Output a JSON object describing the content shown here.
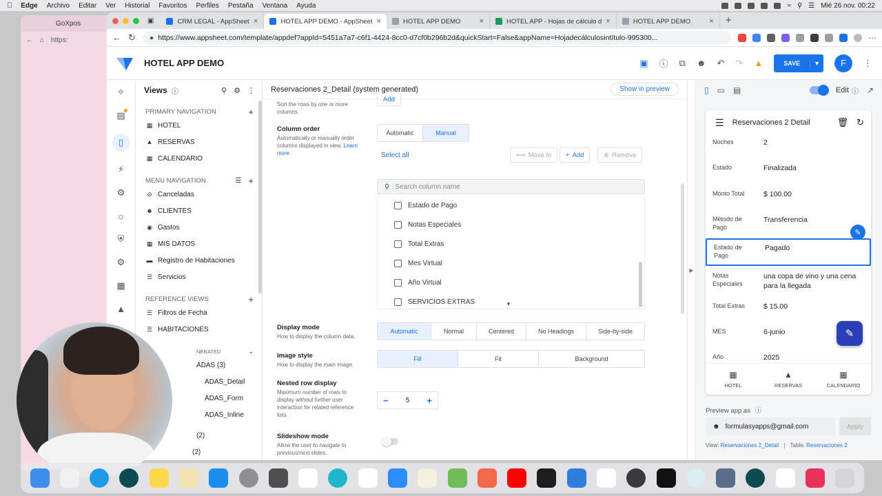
{
  "menubar": {
    "items": [
      "Edge",
      "Archivo",
      "Editar",
      "Ver",
      "Historial",
      "Favoritos",
      "Perfiles",
      "Pestaña",
      "Ventana",
      "Ayuda"
    ],
    "datetime": "Mié 26 nov. 00:22"
  },
  "back_window": {
    "tab": "GoXpos",
    "url": "https:"
  },
  "browser": {
    "tabs": [
      {
        "label": "CRM LEGAL - AppSheet",
        "color": "#1a73e8"
      },
      {
        "label": "HOTEL APP DEMO - AppSheet",
        "color": "#1a73e8"
      },
      {
        "label": "HOTEL APP DEMO",
        "color": "#9aa0a6"
      },
      {
        "label": "HOTEL APP - Hojas de cálculo d",
        "color": "#0f9d58"
      },
      {
        "label": "HOTEL APP DEMO",
        "color": "#9aa0a6"
      }
    ],
    "url": "https://www.appsheet.com/template/appdef?appId=5451a7a7-c6f1-4424-8cc0-d7cf0b296b2d&quickStart=False&appName=Hojadecálculosintítulo-995300..."
  },
  "app": {
    "title": "HOTEL APP DEMO",
    "save_label": "SAVE",
    "avatar_letter": "F"
  },
  "views_panel": {
    "title": "Views",
    "primary_label": "PRIMARY NAVIGATION",
    "primary_items": [
      "HOTEL",
      "RESERVAS",
      "CALENDARIO"
    ],
    "menu_label": "MENU NAVIGATION",
    "menu_items": [
      "Canceladas",
      "CLIENTES",
      "Gastos",
      "MIS DATOS",
      "Registro de Habitaciones",
      "Servicios"
    ],
    "reference_label": "REFERENCE VIEWS",
    "reference_items": [
      "Filtros de Fecha",
      "HABITACIONES"
    ],
    "generated_label": "NERATED",
    "generated_items": [
      "ADAS (3)",
      "ADAS_Detail",
      "ADAS_Form",
      "ADAS_Inline",
      "(2)",
      "(2)"
    ]
  },
  "editor": {
    "title": "Reservaciones 2_Detail (system generated)",
    "show_in_preview": "Show in preview",
    "sort_desc": "Sort the rows by one or more columns.",
    "add_top": "Add",
    "column_order": {
      "label": "Column order",
      "desc": "Automatically or manually order columns displayed in view.",
      "link": "Learn more",
      "options": [
        "Automatic",
        "Manual"
      ],
      "selected": "Manual",
      "select_all": "Select all",
      "move_to": "Move to",
      "add": "Add",
      "remove": "Remove",
      "search_placeholder": "Search column name",
      "columns": [
        "Estado de Pago",
        "Notas Especiales",
        "Total Extras",
        "Mes Virtual",
        "Año Virtual",
        "SERVICIOS EXTRAS"
      ]
    },
    "display_mode": {
      "label": "Display mode",
      "desc": "How to display the column data.",
      "options": [
        "Automatic",
        "Normal",
        "Centered",
        "No Headings",
        "Side-by-side"
      ],
      "selected": "Automatic"
    },
    "image_style": {
      "label": "Image style",
      "desc": "How to display the main image.",
      "options": [
        "Fill",
        "Fit",
        "Background"
      ],
      "selected": "Fill"
    },
    "nested": {
      "label": "Nested row display",
      "desc": "Maximum number of rows to display without further user interaction for related reference lists.",
      "value": "5"
    },
    "slideshow": {
      "label": "Slideshow mode",
      "desc": "Allow the user to navigate to previous/next slides."
    }
  },
  "preview": {
    "edit_label": "Edit",
    "screen_title": "Reservaciones 2 Detail",
    "fields": [
      {
        "label": "Noches",
        "value": "2"
      },
      {
        "label": "Estado",
        "value": "Finalizada"
      },
      {
        "label": "Monto Total",
        "value": "$ 100.00"
      },
      {
        "label": "Método de Pago",
        "value": "Transferencia"
      },
      {
        "label": "Estado de Pago",
        "value": "Pagado"
      },
      {
        "label": "Notas Especiales",
        "value": "una copa de vino y una cena para la llegada"
      },
      {
        "label": "Total Extras",
        "value": "$ 15.00"
      },
      {
        "label": "MES",
        "value": "6-junio"
      },
      {
        "label": "Año",
        "value": "2025"
      }
    ],
    "nav": [
      "HOTEL",
      "RESERVAS",
      "CALENDARIO"
    ],
    "preview_as_label": "Preview app as",
    "preview_as_email": "formulasyapps@gmail.com",
    "apply_label": "Apply",
    "footer_view_label": "View:",
    "footer_view": "Reservaciones 2_Detail",
    "footer_table_label": "Table:",
    "footer_table": "Reservaciones 2"
  },
  "colors": {
    "accent": "#1a73e8",
    "fab": "#2b3fb8",
    "warning": "#f4a100"
  }
}
